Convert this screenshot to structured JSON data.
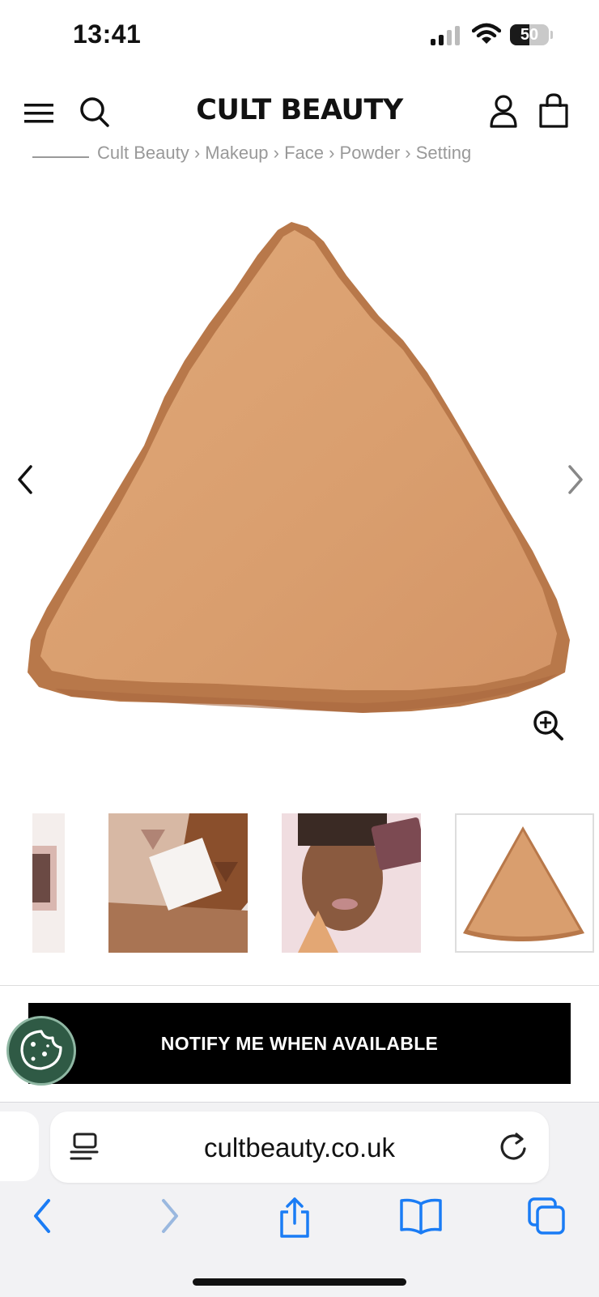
{
  "status_bar": {
    "time": "13:41",
    "battery_level": "50",
    "battery_fraction": 0.5
  },
  "header": {
    "logo": "CULT BEAUTY"
  },
  "breadcrumb": {
    "text": "Cult Beauty  ›  Makeup  ›  Face  ›  Powder  ›  Setting"
  },
  "product": {
    "main_image": "triangle-powder-swatch",
    "thumbnails": [
      {
        "name": "compact-partial"
      },
      {
        "name": "arm-swatches"
      },
      {
        "name": "model-with-compact"
      },
      {
        "name": "triangle-powder"
      }
    ],
    "active_thumbnail_index": 3
  },
  "actions": {
    "notify_label": "NOTIFY ME WHEN AVAILABLE"
  },
  "browser": {
    "url": "cultbeauty.co.uk"
  },
  "colors": {
    "accent": "#000000",
    "cookie": "#2f5a45",
    "safari_blue": "#1a7cf5",
    "powder": "#d99e6e"
  }
}
